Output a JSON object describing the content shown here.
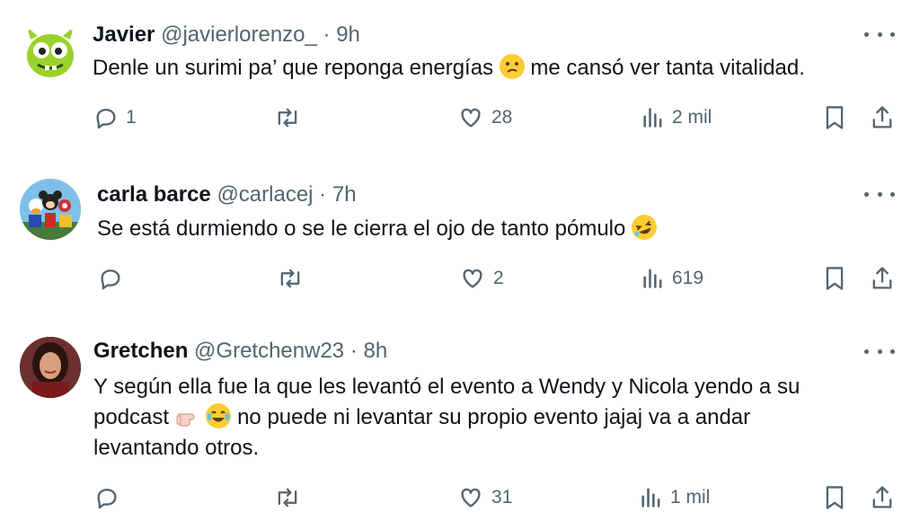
{
  "tweets": [
    {
      "name": "Javier",
      "handle": "@javierlorenzo_",
      "time": "9h",
      "text_a": "Denle un surimi pa’ que reponga energías",
      "text_b": "me cansó ver tanta vitalidad.",
      "replies": "1",
      "retweets": "",
      "likes": "28",
      "views": "2 mil",
      "emoji": "confused-face-emoji"
    },
    {
      "name": "carla barce",
      "handle": "@carlacej",
      "time": "7h",
      "text_a": "Se está durmiendo o se le cierra el ojo de tanto pómulo",
      "replies": "",
      "retweets": "",
      "likes": "2",
      "views": "619",
      "emoji": "rolling-laughing-emoji"
    },
    {
      "name": "Gretchen",
      "handle": "@Gretchenw23",
      "time": "8h",
      "line1": "Y según ella fue la que les levantó el evento a Wendy y Nicola yendo a su",
      "line2_a": "podcast",
      "line2_b": "no puede ni levantar su propio evento jajaj va a andar",
      "line3": "levantando otros.",
      "replies": "",
      "retweets": "",
      "likes": "31",
      "views": "1 mil",
      "emoji": [
        "pointing-hand-emoji",
        "tears-of-joy-emoji"
      ]
    }
  ],
  "separator": "·",
  "colors": {
    "text": "#0f1419",
    "secondary": "#536471",
    "background": "#ffffff"
  }
}
